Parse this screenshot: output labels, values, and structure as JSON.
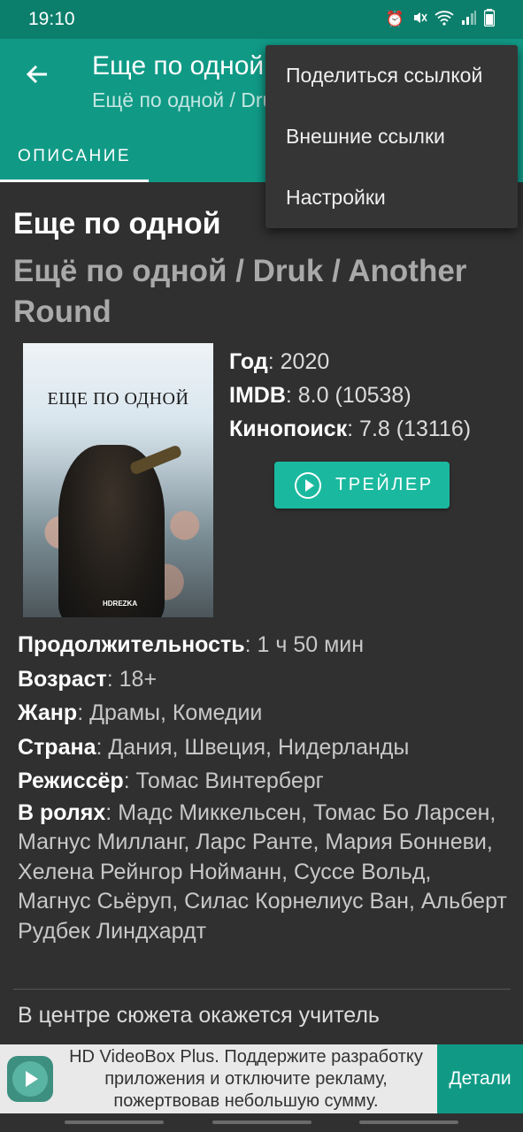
{
  "status_bar": {
    "time": "19:10"
  },
  "app_bar": {
    "title": "Еще по одной",
    "subtitle": "Ещё по одной / Druk / Another Round",
    "tab_label": "ОПИСАНИЕ"
  },
  "menu": {
    "items": [
      {
        "label": "Поделиться ссылкой"
      },
      {
        "label": "Внешние ссылки"
      },
      {
        "label": "Настройки"
      }
    ]
  },
  "movie": {
    "title": "Еще по одной",
    "alt_title": "Ещё по одной / Druk / Another Round",
    "poster_title": "ЕЩЕ ПО ОДНОЙ",
    "poster_logo": "HDREZKA",
    "info": {
      "year_label": "Год",
      "year_value": ": 2020",
      "imdb_label": "IMDB",
      "imdb_value": ": 8.0 (10538)",
      "kp_label": "Кинопоиск",
      "kp_value": ": 7.8 (13116)"
    },
    "trailer_label": "ТРЕЙЛЕР",
    "details": {
      "duration_label": "Продолжительность",
      "duration_value": ": 1 ч 50 мин",
      "age_label": "Возраст",
      "age_value": ": 18+",
      "genre_label": "Жанр",
      "genre_value": ": Драмы, Комедии",
      "country_label": "Страна",
      "country_value": ": Дания, Швеция, Нидерланды",
      "director_label": "Режиссёр",
      "director_value": ": Томас Винтерберг",
      "cast_label": "В ролях",
      "cast_value": ": Мадс Миккельсен, Томас Бо Ларсен, Магнус Милланг, Ларс Ранте, Мария Бонневи, Хелена Рейнгор Нойманн, Суссе Вольд, Магнус Сьëруп, Силас Корнелиус Ван, Альберт Рудбек Линдхардт"
    },
    "synopsis": "В центре сюжета окажется учитель"
  },
  "ad": {
    "text": "HD VideoBox Plus. Поддержите разработку приложения и отключите рекламу, пожертвовав небольшую сумму.",
    "button_label": "Детали"
  },
  "colors": {
    "accent": "#109a86",
    "status_bar": "#0c7f6c",
    "button": "#1ab99f",
    "background": "#303030"
  }
}
